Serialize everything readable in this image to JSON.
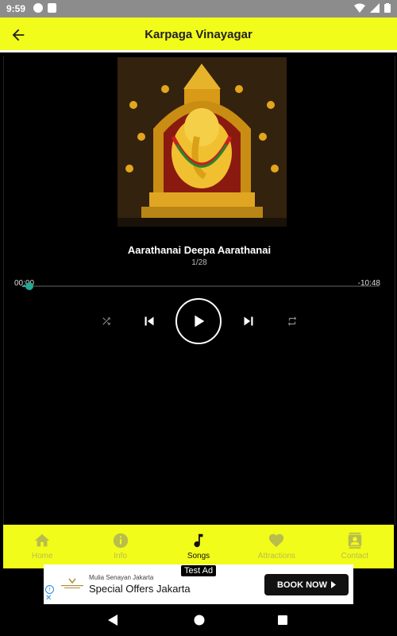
{
  "status_bar": {
    "time": "9:59"
  },
  "app_bar": {
    "title": "Karpaga Vinayagar"
  },
  "player": {
    "song_title": "Aarathanai Deepa Aarathanai",
    "track_position": "1/28",
    "current_time": "00:00",
    "remaining_time": "-10:48",
    "progress": 0.02
  },
  "bottom_nav": {
    "items": [
      {
        "label": "Home",
        "icon": "home-icon"
      },
      {
        "label": "Info",
        "icon": "info-icon"
      },
      {
        "label": "Songs",
        "icon": "music-note-icon"
      },
      {
        "label": "Attractions",
        "icon": "heart-icon"
      },
      {
        "label": "Contact",
        "icon": "contact-icon"
      }
    ],
    "active_index": 2
  },
  "ad": {
    "tag": "Test Ad",
    "advertiser": "Mulia Senayan Jakarta",
    "headline": "Special Offers Jakarta",
    "cta": "BOOK NOW"
  },
  "colors": {
    "accent_yellow": "#f2fc1a",
    "seek_teal": "#24a893",
    "background": "#000000"
  }
}
